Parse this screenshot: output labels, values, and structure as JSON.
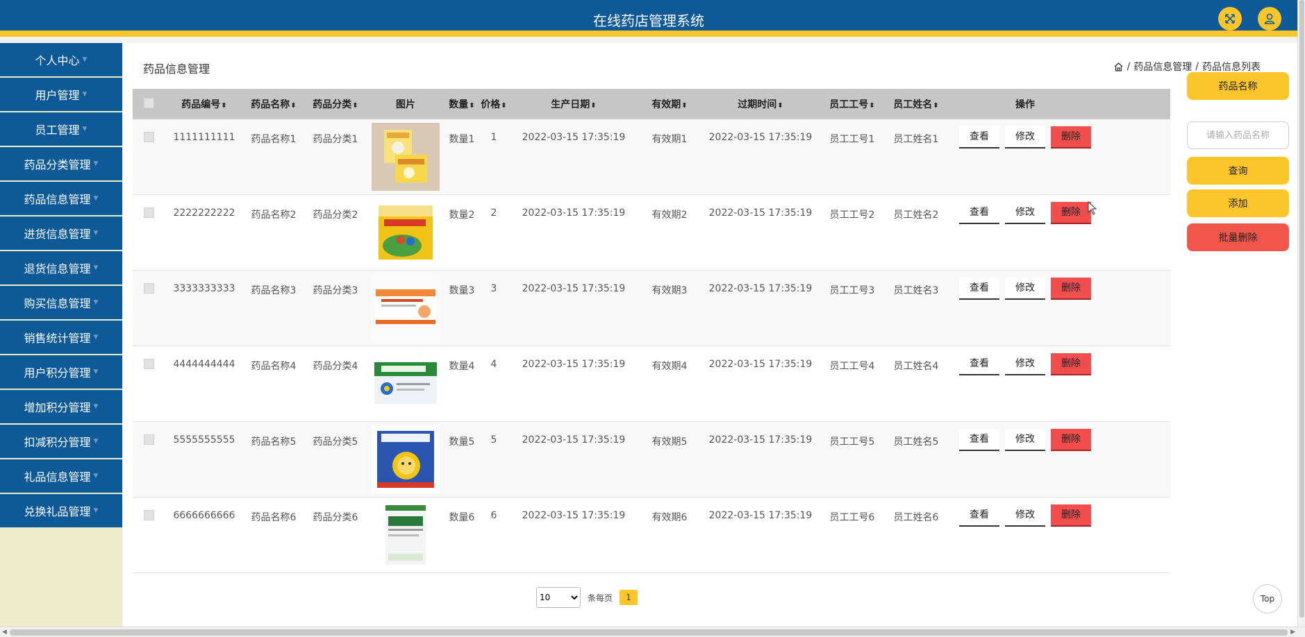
{
  "header": {
    "title": "在线药店管理系统"
  },
  "sidebar": {
    "items": [
      {
        "label": "个人中心"
      },
      {
        "label": "用户管理"
      },
      {
        "label": "员工管理"
      },
      {
        "label": "药品分类管理"
      },
      {
        "label": "药品信息管理"
      },
      {
        "label": "进货信息管理"
      },
      {
        "label": "退货信息管理"
      },
      {
        "label": "购买信息管理"
      },
      {
        "label": "销售统计管理"
      },
      {
        "label": "用户积分管理"
      },
      {
        "label": "增加积分管理"
      },
      {
        "label": "扣减积分管理"
      },
      {
        "label": "礼品信息管理"
      },
      {
        "label": "兑换礼品管理"
      }
    ]
  },
  "main": {
    "page_title": "药品信息管理",
    "breadcrumb": {
      "level1": "药品信息管理",
      "level2": "药品信息列表",
      "separator": "/"
    }
  },
  "table": {
    "headers": {
      "code": "药品编号",
      "name": "药品名称",
      "category": "药品分类",
      "image": "图片",
      "qty": "数量",
      "price": "价格",
      "prod_date": "生产日期",
      "validity": "有效期",
      "expiry": "过期时间",
      "emp_no": "员工工号",
      "emp_name": "员工姓名",
      "ops": "操作"
    },
    "buttons": {
      "view": "查看",
      "edit": "修改",
      "delete": "删除"
    },
    "rows": [
      {
        "code": "1111111111",
        "name": "药品名称1",
        "category": "药品分类1",
        "qty": "数量1",
        "price": "1",
        "prod_date": "2022-03-15 17:35:19",
        "validity": "有效期1",
        "expiry": "2022-03-15 17:35:19",
        "emp_no": "员工工号1",
        "emp_name": "员工姓名1"
      },
      {
        "code": "2222222222",
        "name": "药品名称2",
        "category": "药品分类2",
        "qty": "数量2",
        "price": "2",
        "prod_date": "2022-03-15 17:35:19",
        "validity": "有效期2",
        "expiry": "2022-03-15 17:35:19",
        "emp_no": "员工工号2",
        "emp_name": "员工姓名2"
      },
      {
        "code": "3333333333",
        "name": "药品名称3",
        "category": "药品分类3",
        "qty": "数量3",
        "price": "3",
        "prod_date": "2022-03-15 17:35:19",
        "validity": "有效期3",
        "expiry": "2022-03-15 17:35:19",
        "emp_no": "员工工号3",
        "emp_name": "员工姓名3"
      },
      {
        "code": "4444444444",
        "name": "药品名称4",
        "category": "药品分类4",
        "qty": "数量4",
        "price": "4",
        "prod_date": "2022-03-15 17:35:19",
        "validity": "有效期4",
        "expiry": "2022-03-15 17:35:19",
        "emp_no": "员工工号4",
        "emp_name": "员工姓名4"
      },
      {
        "code": "5555555555",
        "name": "药品名称5",
        "category": "药品分类5",
        "qty": "数量5",
        "price": "5",
        "prod_date": "2022-03-15 17:35:19",
        "validity": "有效期5",
        "expiry": "2022-03-15 17:35:19",
        "emp_no": "员工工号5",
        "emp_name": "员工姓名5"
      },
      {
        "code": "6666666666",
        "name": "药品名称6",
        "category": "药品分类6",
        "qty": "数量6",
        "price": "6",
        "prod_date": "2022-03-15 17:35:19",
        "validity": "有效期6",
        "expiry": "2022-03-15 17:35:19",
        "emp_no": "员工工号6",
        "emp_name": "员工姓名6"
      }
    ]
  },
  "search_panel": {
    "field_label": "药品名称",
    "placeholder": "请输入药品名称",
    "query": "查询",
    "add": "添加",
    "batch_delete": "批量删除"
  },
  "pager": {
    "page_size": "10",
    "per_page_label": "条每页",
    "current_page": "1"
  },
  "top_button": "Top",
  "colors": {
    "primary": "#0e5a99",
    "accent": "#fcc52a",
    "danger": "#f24e4e",
    "sidebar_bg": "#efeccc"
  },
  "icons": {
    "fullscreen": "expand-icon",
    "user": "user-icon",
    "home": "home-icon"
  }
}
